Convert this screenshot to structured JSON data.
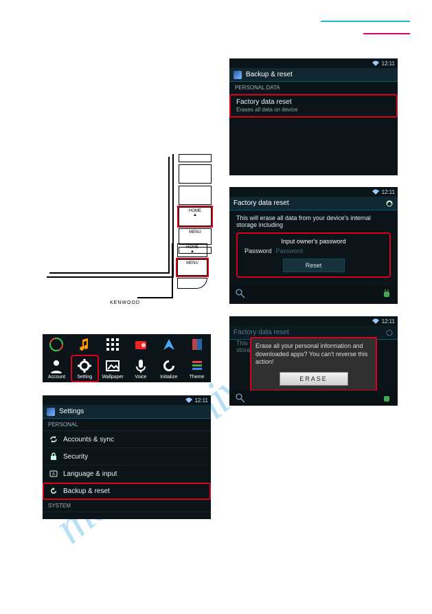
{
  "time": "12:11",
  "device": {
    "buttons": [
      "",
      "",
      "",
      "HOME",
      "MENU",
      ""
    ],
    "logo": "KENWOOD"
  },
  "device2": {
    "buttons": [
      "HOME",
      "MENU",
      ""
    ]
  },
  "iconbar": {
    "apps": [
      {
        "label": "Account"
      },
      {
        "label": "Setting"
      },
      {
        "label": "Wallpaper"
      },
      {
        "label": "Voice"
      },
      {
        "label": "Initialize"
      },
      {
        "label": "Theme"
      }
    ]
  },
  "settings": {
    "title": "Settings",
    "section1": "PERSONAL",
    "rows": [
      {
        "icon": "sync",
        "label": "Accounts & sync"
      },
      {
        "icon": "lock",
        "label": "Security"
      },
      {
        "icon": "lang",
        "label": "Language & input"
      },
      {
        "icon": "backup",
        "label": "Backup & reset"
      }
    ],
    "section2": "SYSTEM"
  },
  "backup": {
    "title": "Backup & reset",
    "section": "PERSONAL DATA",
    "row_label": "Factory data reset",
    "row_sub": "Erases all data on device"
  },
  "fdr1": {
    "title": "Factory data reset",
    "body": "This will erase all data from your device's internal storage including",
    "pw_header": "Input owner's password",
    "pw_label": "Password",
    "pw_placeholder": "Password",
    "reset_btn": "Reset"
  },
  "fdr2": {
    "title": "Factory data reset",
    "dim": "This will erase all data from your device's internal storage inclu",
    "dlg": "Erase all your personal information and downloaded apps? You can't reverse this action!",
    "erase_btn": "ERASE"
  }
}
